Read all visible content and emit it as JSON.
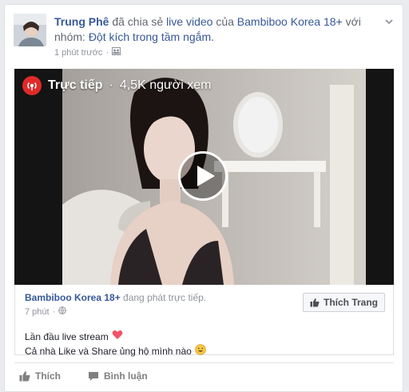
{
  "post": {
    "author": "Trung Phê",
    "action_text": " đã chia sẻ ",
    "link_text": "live video",
    "of_text": " của ",
    "page_name": "Bambiboo Korea 18+",
    "with_group_text": " với nhóm: ",
    "group_name": "Đột kích trong tầm ngắm.",
    "time": "1 phút trước",
    "privacy_icon": "group-icon"
  },
  "video": {
    "live_label": "Trực tiếp",
    "separator": "·",
    "viewers": "4,5K người xem"
  },
  "shared": {
    "page_name": "Bambiboo Korea 18+",
    "status": " đang phát trực tiếp.",
    "time": "7 phút",
    "separator": "·",
    "like_page_button": "Thích Trang",
    "message_line1": "Lần đầu live stream",
    "message_line2": "Cả nhà Like và Share ủng hộ mình nào"
  },
  "actions": {
    "like": "Thích",
    "comment": "Bình luận"
  },
  "colors": {
    "link": "#365899",
    "live_red": "#e02a2a",
    "heart": "#f25268"
  }
}
